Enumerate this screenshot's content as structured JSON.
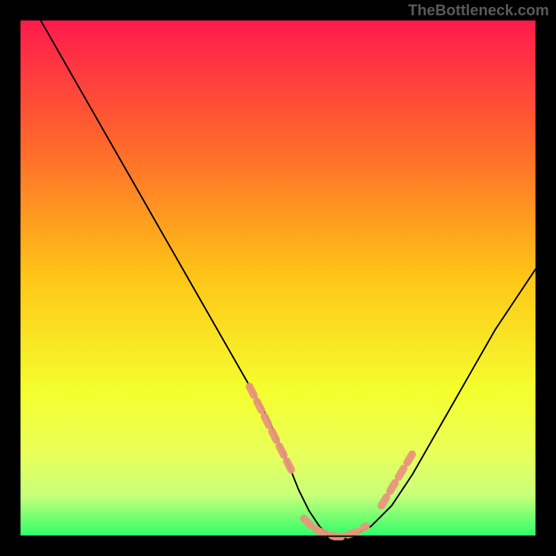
{
  "watermark": "TheBottleneck.com",
  "chart_data": {
    "type": "line",
    "title": "",
    "xlabel": "",
    "ylabel": "",
    "xlim": [
      0,
      100
    ],
    "ylim": [
      0,
      100
    ],
    "background": {
      "type": "vertical-gradient",
      "stops": [
        {
          "offset": 0,
          "color": "#ff1a4d"
        },
        {
          "offset": 25,
          "color": "#ff6a2b"
        },
        {
          "offset": 50,
          "color": "#ffc617"
        },
        {
          "offset": 72,
          "color": "#f4ff2e"
        },
        {
          "offset": 84,
          "color": "#e9ff5a"
        },
        {
          "offset": 92,
          "color": "#c8ff7a"
        },
        {
          "offset": 100,
          "color": "#2cff6a"
        }
      ]
    },
    "series": [
      {
        "name": "bottleneck-curve",
        "color": "#000000",
        "x": [
          4,
          8,
          12,
          16,
          20,
          24,
          28,
          32,
          36,
          40,
          44,
          48,
          52,
          54,
          56,
          58,
          60,
          62,
          64,
          68,
          72,
          76,
          80,
          84,
          88,
          92,
          96,
          100
        ],
        "y": [
          100,
          93,
          86,
          79,
          72,
          65,
          58,
          51,
          44,
          37,
          30,
          23,
          14,
          9,
          5,
          2,
          0,
          0,
          0,
          2,
          6,
          12,
          19,
          26,
          33,
          40,
          46,
          52
        ]
      }
    ],
    "highlight_segments": [
      {
        "name": "left-ramp-highlight",
        "color": "#e9967a",
        "x": [
          44.5,
          45.5,
          47,
          48.5,
          50,
          51.5,
          53
        ],
        "y": [
          29,
          27,
          24,
          21,
          18,
          15,
          12
        ]
      },
      {
        "name": "valley-highlight",
        "color": "#e9967a",
        "x": [
          55,
          56.5,
          58,
          59.5,
          61,
          62.5,
          64,
          65.5,
          67
        ],
        "y": [
          3.5,
          2,
          1,
          0.5,
          0,
          0,
          0.5,
          1,
          2
        ]
      },
      {
        "name": "right-ramp-highlight",
        "color": "#e9967a",
        "x": [
          70,
          71.5,
          73,
          74.5,
          76
        ],
        "y": [
          6,
          8.5,
          11,
          13.5,
          16
        ]
      }
    ],
    "frame": {
      "color": "#000000",
      "thickness_outer": 28,
      "thickness_inner": 2
    }
  }
}
